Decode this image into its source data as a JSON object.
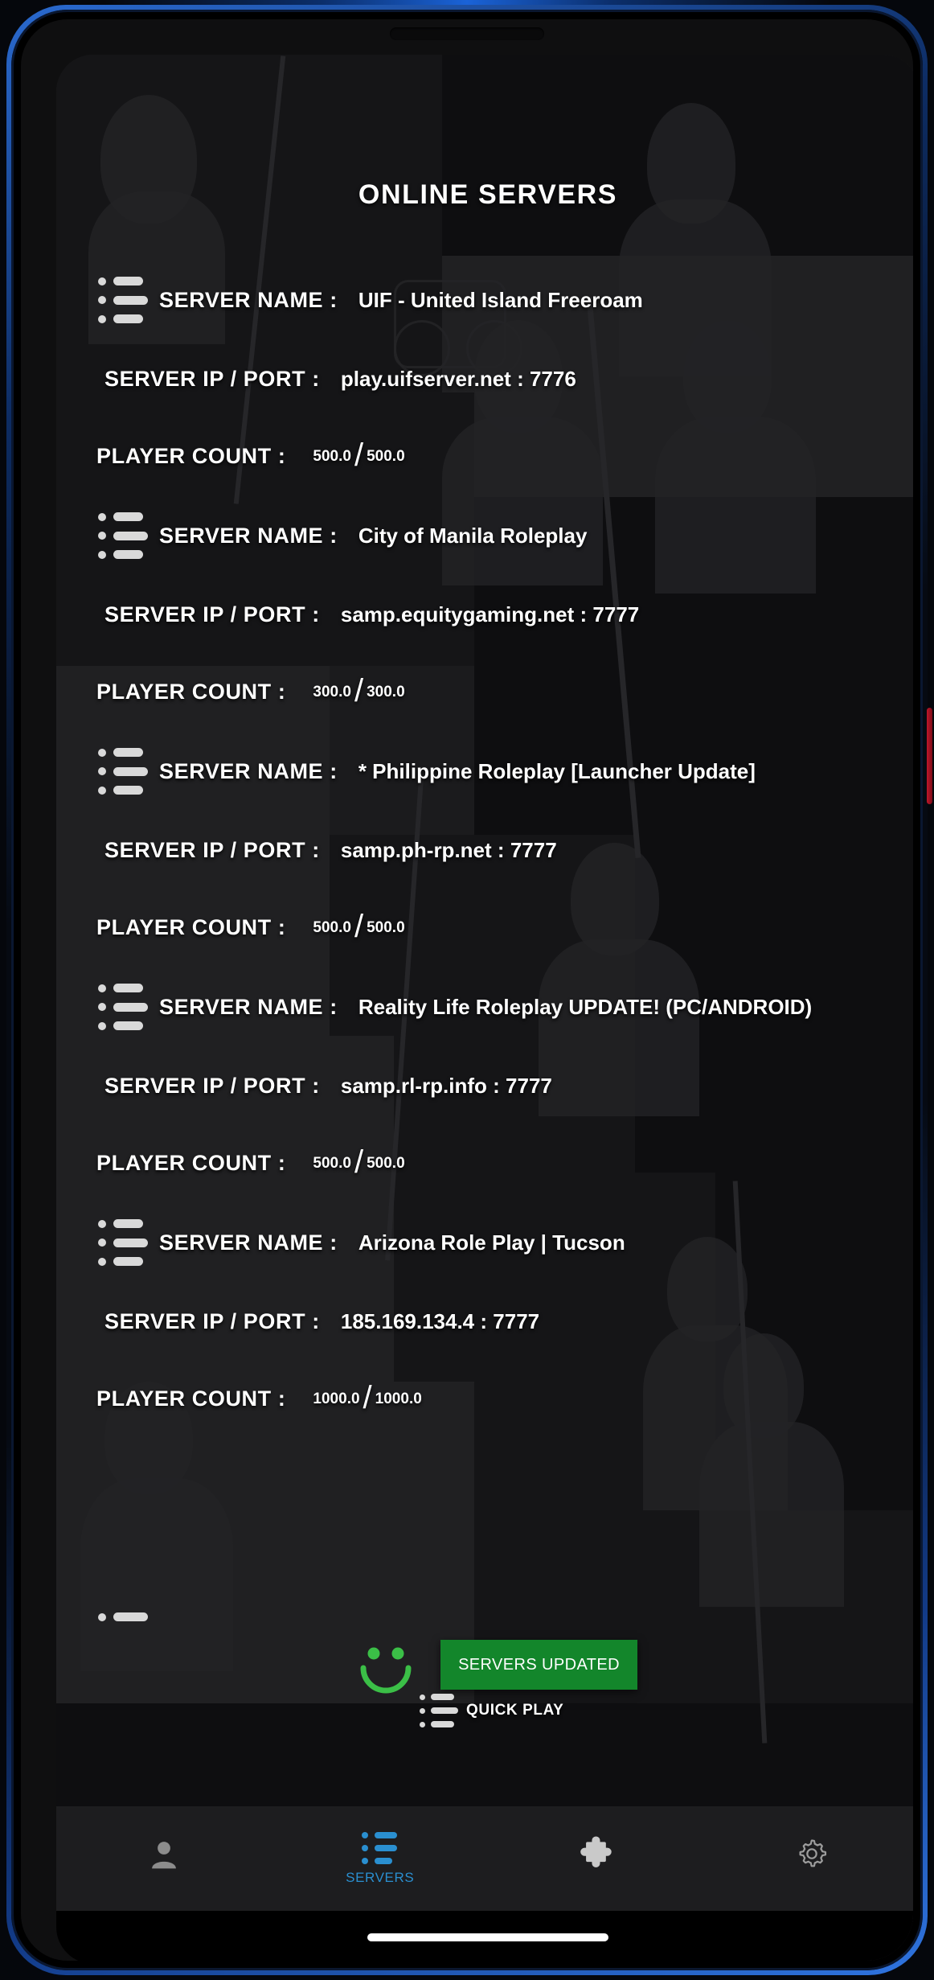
{
  "app": {
    "title": "ONLINE SERVERS"
  },
  "labels": {
    "server_name": "SERVER NAME :",
    "server_ip_port": "SERVER IP / PORT :",
    "player_count": "PLAYER COUNT :",
    "separator": "/",
    "port_separator": ":"
  },
  "servers": [
    {
      "name": "UIF - United Island Freeroam",
      "ip": "play.uifserver.net",
      "port": "7776",
      "players_online": "500.0",
      "players_max": "500.0"
    },
    {
      "name": "City of Manila Roleplay",
      "ip": "samp.equitygaming.net",
      "port": "7777",
      "players_online": "300.0",
      "players_max": "300.0"
    },
    {
      "name": "* Philippine Roleplay [Launcher Update]",
      "ip": "samp.ph-rp.net",
      "port": "7777",
      "players_online": "500.0",
      "players_max": "500.0"
    },
    {
      "name": "Reality Life Roleplay UPDATE! (PC/ANDROID)",
      "ip": "samp.rl-rp.info",
      "port": "7777",
      "players_online": "500.0",
      "players_max": "500.0"
    },
    {
      "name": "Arizona Role Play | Tucson",
      "ip": "185.169.134.4",
      "port": "7777",
      "players_online": "1000.0",
      "players_max": "1000.0"
    }
  ],
  "toast": {
    "message": "SERVERS UPDATED",
    "color": "#13862b",
    "icon": "smiley-icon"
  },
  "partial_item": {
    "quick_play_label": "QUICK PLAY"
  },
  "bottom_nav": {
    "active_color": "#2a8fd0",
    "inactive_color": "#8c8c8c",
    "items": [
      {
        "icon": "person-icon",
        "label": "",
        "active": false
      },
      {
        "icon": "server-list-icon",
        "label": "SERVERS",
        "active": true
      },
      {
        "icon": "puzzle-icon",
        "label": "",
        "active": false
      },
      {
        "icon": "gear-icon",
        "label": "",
        "active": false
      }
    ]
  }
}
